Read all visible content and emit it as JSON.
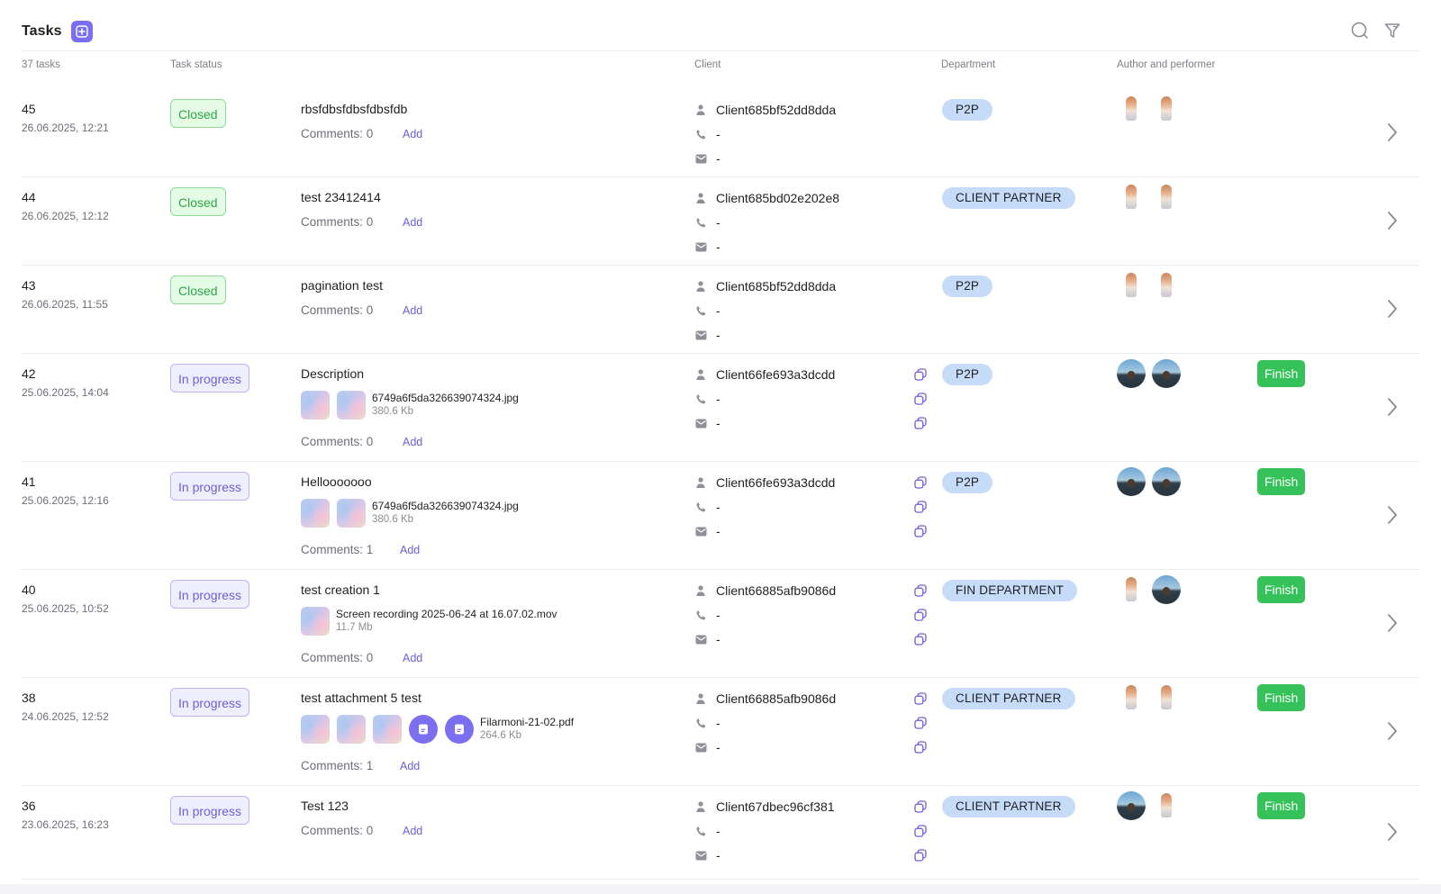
{
  "header": {
    "title": "Tasks"
  },
  "columns": {
    "count": "37 tasks",
    "status": "Task status",
    "client": "Client",
    "department": "Department",
    "author": "Author and performer"
  },
  "tasks": [
    {
      "id": "45",
      "date": "26.06.2025, 12:21",
      "status": "Closed",
      "title": "rbsfdbsfdbsfdbsfdb",
      "comments": "Comments: 0",
      "add": "Add",
      "client": "Client685bf52dd8dda",
      "phone": "-",
      "email": "-",
      "dept": "P2P",
      "avatars": [
        "girl",
        "girl"
      ]
    },
    {
      "id": "44",
      "date": "26.06.2025, 12:12",
      "status": "Closed",
      "title": "test 23412414",
      "comments": "Comments: 0",
      "add": "Add",
      "client": "Client685bd02e202e8",
      "phone": "-",
      "email": "-",
      "dept": "CLIENT PARTNER",
      "avatars": [
        "girl",
        "girl"
      ]
    },
    {
      "id": "43",
      "date": "26.06.2025, 11:55",
      "status": "Closed",
      "title": "pagination test",
      "comments": "Comments: 0",
      "add": "Add",
      "client": "Client685bf52dd8dda",
      "phone": "-",
      "email": "-",
      "dept": "P2P",
      "avatars": [
        "girl",
        "girl"
      ]
    },
    {
      "id": "42",
      "date": "25.06.2025, 14:04",
      "status": "In progress",
      "title": "Description",
      "comments": "Comments: 0",
      "add": "Add",
      "client": "Client66fe693a3dcdd",
      "phone": "-",
      "email": "-",
      "dept": "P2P",
      "avatars": [
        "sea",
        "sea"
      ],
      "finish": "Finish",
      "attachments": {
        "thumbs": 2,
        "files": 0,
        "name": "6749a6f5da326639074324.jpg",
        "size": "380.6 Kb"
      }
    },
    {
      "id": "41",
      "date": "25.06.2025, 12:16",
      "status": "In progress",
      "title": "Hellooooooo",
      "comments": "Comments: 1",
      "add": "Add",
      "client": "Client66fe693a3dcdd",
      "phone": "-",
      "email": "-",
      "dept": "P2P",
      "avatars": [
        "sea",
        "sea"
      ],
      "finish": "Finish",
      "attachments": {
        "thumbs": 2,
        "files": 0,
        "name": "6749a6f5da326639074324.jpg",
        "size": "380.6 Kb"
      }
    },
    {
      "id": "40",
      "date": "25.06.2025, 10:52",
      "status": "In progress",
      "title": "test creation 1",
      "comments": "Comments: 0",
      "add": "Add",
      "client": "Client66885afb9086d",
      "phone": "-",
      "email": "-",
      "dept": "FIN DEPARTMENT",
      "avatars": [
        "girl",
        "sea"
      ],
      "finish": "Finish",
      "attachments": {
        "thumbs": 1,
        "files": 0,
        "name": "Screen recording 2025-06-24 at 16.07.02.mov",
        "size": "11.7 Mb"
      }
    },
    {
      "id": "38",
      "date": "24.06.2025, 12:52",
      "status": "In progress",
      "title": "test attachment 5 test",
      "comments": "Comments: 1",
      "add": "Add",
      "client": "Client66885afb9086d",
      "phone": "-",
      "email": "-",
      "dept": "CLIENT PARTNER",
      "avatars": [
        "girl",
        "girl"
      ],
      "finish": "Finish",
      "attachments": {
        "thumbs": 3,
        "files": 2,
        "name": "Filarmoni-21-02.pdf",
        "size": "264.6 Kb"
      }
    },
    {
      "id": "36",
      "date": "23.06.2025, 16:23",
      "status": "In progress",
      "title": "Test 123",
      "comments": "Comments: 0",
      "add": "Add",
      "client": "Client67dbec96cf381",
      "phone": "-",
      "email": "-",
      "dept": "CLIENT PARTNER",
      "avatars": [
        "sea",
        "girl"
      ],
      "finish": "Finish"
    }
  ],
  "colors": {
    "accent": "#7b6ff0",
    "closed": "#2ea548",
    "progress": "#6b5fd8",
    "finish": "#35c25a",
    "dept": "#c6dbf8"
  },
  "icons": {
    "search": "search-icon",
    "filter": "filter-icon",
    "add": "plus-icon",
    "chevron": "chevron-right-icon",
    "copy": "copy-icon",
    "person": "person-icon",
    "phone": "phone-icon",
    "mail": "mail-icon",
    "file": "file-icon"
  }
}
